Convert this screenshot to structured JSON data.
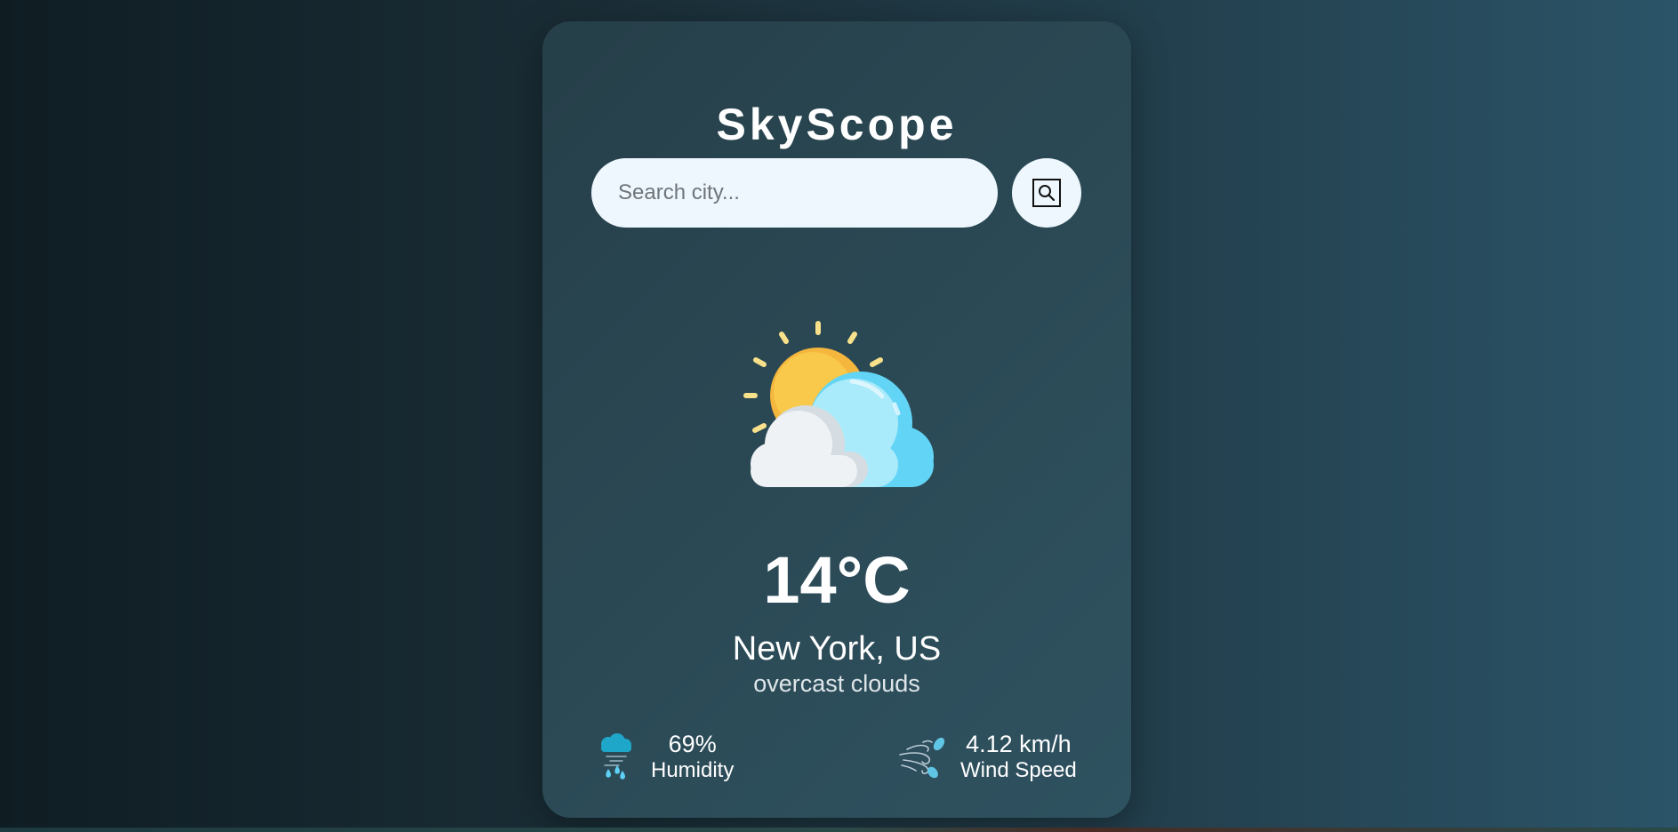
{
  "app": {
    "title": "SkyScope"
  },
  "search": {
    "placeholder": "Search city...",
    "value": ""
  },
  "weather": {
    "icon": "partly-cloudy-icon",
    "temperature": "14°C",
    "location": "New York, US",
    "description": "overcast clouds"
  },
  "stats": {
    "humidity": {
      "icon": "humidity-icon",
      "value": "69%",
      "label": "Humidity"
    },
    "wind": {
      "icon": "wind-icon",
      "value": "4.12 km/h",
      "label": "Wind Speed"
    }
  },
  "colors": {
    "card_background": "#2b4a56",
    "input_background": "#eef7fd",
    "sun": "#f7c245",
    "cloud_blue": "#5fd0f5",
    "cloud_white": "#eef2f4"
  }
}
